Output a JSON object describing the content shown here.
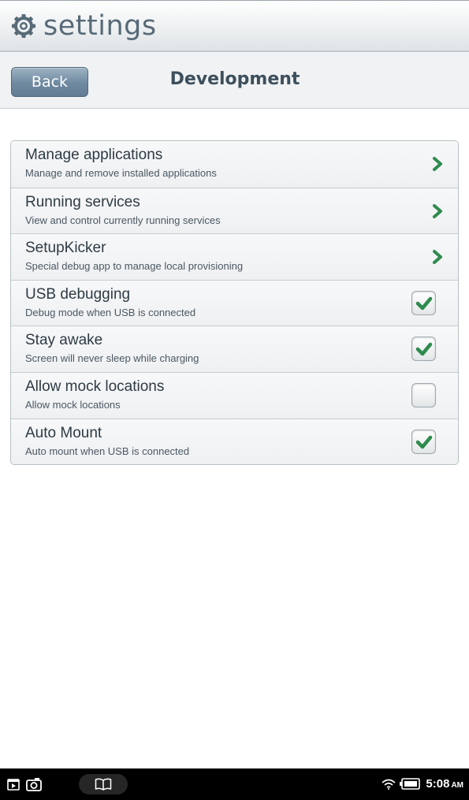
{
  "header": {
    "app_title": "settings",
    "icon": "gear-icon"
  },
  "subheader": {
    "back_label": "Back",
    "page_title": "Development"
  },
  "settings": [
    {
      "title": "Manage applications",
      "subtitle": "Manage and remove installed applications",
      "control": "chevron"
    },
    {
      "title": "Running services",
      "subtitle": "View and control currently running services",
      "control": "chevron"
    },
    {
      "title": "SetupKicker",
      "subtitle": "Special debug app to manage local provisioning",
      "control": "chevron"
    },
    {
      "title": "USB debugging",
      "subtitle": "Debug mode when USB is connected",
      "control": "checkbox",
      "checked": true
    },
    {
      "title": "Stay awake",
      "subtitle": "Screen will never sleep while charging",
      "control": "checkbox",
      "checked": true
    },
    {
      "title": "Allow mock locations",
      "subtitle": "Allow mock locations",
      "control": "checkbox",
      "checked": false
    },
    {
      "title": "Auto Mount",
      "subtitle": "Auto mount when USB is connected",
      "control": "checkbox",
      "checked": true
    }
  ],
  "status_bar": {
    "time": "5:08",
    "ampm": "AM",
    "icons": [
      "app-notification-icon",
      "camera-icon",
      "book-icon",
      "wifi-icon",
      "battery-icon"
    ]
  },
  "colors": {
    "accent_green": "#2e8b4e",
    "title_blue": "#576a78",
    "back_button": "#6f89a0"
  }
}
